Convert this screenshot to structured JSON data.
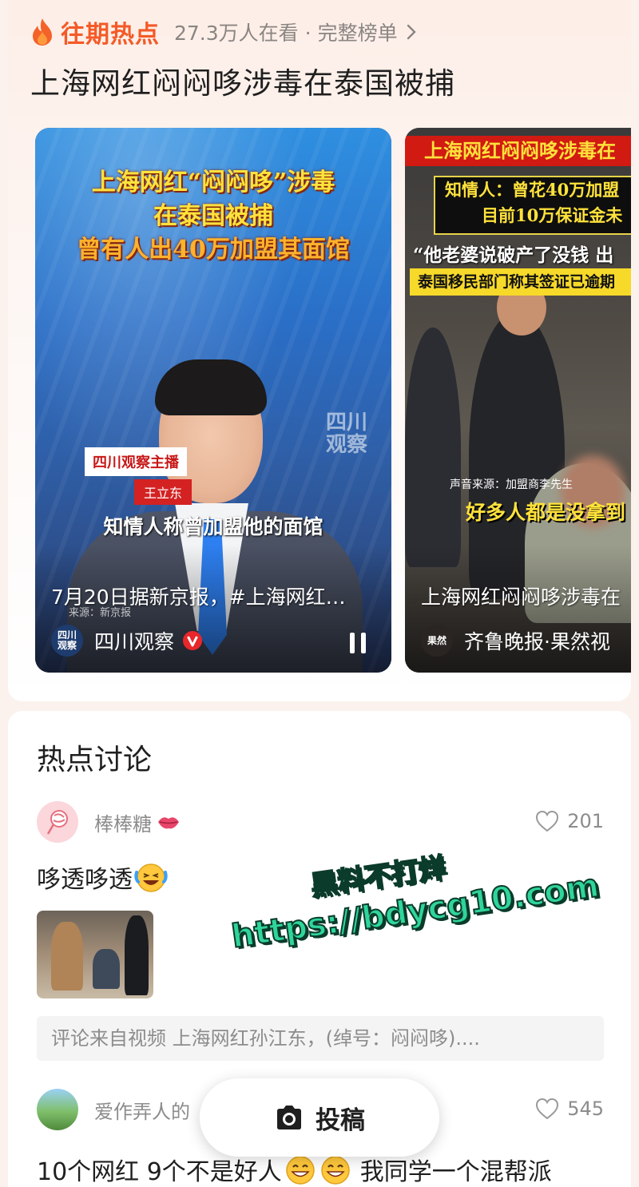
{
  "hot": {
    "title": "往期热点",
    "viewers": "27.3万人在看 ·",
    "full_list": "完整榜单",
    "topic": "上海网红闷闷哆涉毒在泰国被捕"
  },
  "videos": [
    {
      "overlay_line1": "上海网红“闷闷哆”涉毒",
      "overlay_line2": "在泰国被捕",
      "overlay_line3": "曾有人出40万加盟其面馆",
      "badge_show": "四川观察主播",
      "badge_name": "王立东",
      "subtitle": "知情人称曾加盟他的面馆",
      "watermark_line1": "四川",
      "watermark_line2": "观察",
      "source_text": "来源：新京报",
      "description": "7月20日据新京报，#上海网红…",
      "avatar_line1": "四川",
      "avatar_line2": "观察",
      "author": "四川观察"
    },
    {
      "overlay_title": "上海网红闷闷哆涉毒在",
      "overlay_box_line1": "知情人：曾花40万加盟",
      "overlay_box_line2": "目前10万保证金未",
      "overlay_quote": "“他老婆说破产了没钱 出",
      "overlay_notice": "泰国移民部门称其签证已逾期",
      "source_text": "声音来源：加盟商李先生",
      "quote_bottom": "好多人都是没拿到",
      "description": "上海网红闷闷哆涉毒在",
      "avatar_text": "果然",
      "author": "齐鲁晚报·果然视"
    }
  ],
  "discussion": {
    "title": "热点讨论",
    "comments": [
      {
        "user": "棒棒糖",
        "likes": "201",
        "text": "哆透哆透",
        "source": "评论来自视频 上海网红孙江东，(绰号：闷闷哆)...."
      },
      {
        "user": "爱作弄人的",
        "likes": "545",
        "text_a": "10个网红 9个不是好人",
        "text_b": "我同学一个混帮派"
      }
    ]
  },
  "post_button": {
    "label": "投稿"
  },
  "watermark": {
    "line1": "黑料不打烊",
    "line2": "https://bdycg10.com"
  },
  "colors": {
    "accent": "#f45a27",
    "muted_text": "#8c8c8c",
    "verified": "#e8272b"
  },
  "icons": [
    "flame-icon",
    "chevron-right-icon",
    "verified-icon",
    "pause-icon",
    "heart-icon",
    "camera-icon",
    "lips-icon",
    "laughing-emoji-icon",
    "grinning-emoji-icon"
  ]
}
